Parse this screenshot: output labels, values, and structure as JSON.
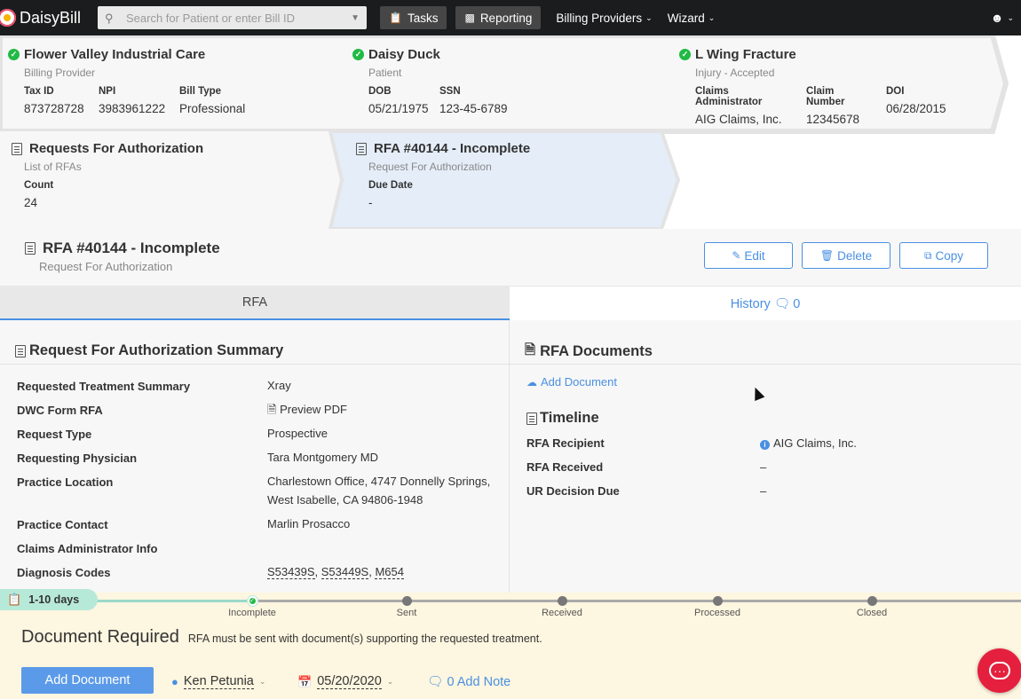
{
  "app": {
    "name": "DaisyBill"
  },
  "nav": {
    "search_placeholder": "Search for Patient or enter Bill ID",
    "tasks_label": "Tasks",
    "reporting_label": "Reporting",
    "billing_providers_label": "Billing Providers",
    "wizard_label": "Wizard"
  },
  "breadcrumbs": {
    "provider": {
      "title": "Flower Valley Industrial Care",
      "subtitle": "Billing Provider",
      "fields": [
        {
          "label": "Tax ID",
          "value": "873728728"
        },
        {
          "label": "NPI",
          "value": "3983961222"
        },
        {
          "label": "Bill Type",
          "value": "Professional"
        }
      ]
    },
    "patient": {
      "title": "Daisy Duck",
      "subtitle": "Patient",
      "fields": [
        {
          "label": "DOB",
          "value": "05/21/1975"
        },
        {
          "label": "SSN",
          "value": "123-45-6789"
        }
      ]
    },
    "injury": {
      "title": "L Wing Fracture",
      "subtitle": "Injury - Accepted",
      "fields": [
        {
          "label": "Claims Administrator",
          "value": "AIG Claims, Inc."
        },
        {
          "label": "Claim Number",
          "value": "12345678"
        },
        {
          "label": "DOI",
          "value": "06/28/2015"
        }
      ]
    },
    "rfas": {
      "title": "Requests For Authorization",
      "subtitle": "List of RFAs",
      "fields": [
        {
          "label": "Count",
          "value": "24"
        }
      ]
    },
    "current": {
      "title": "RFA #40144 - Incomplete",
      "subtitle": "Request For Authorization",
      "fields": [
        {
          "label": "Due Date",
          "value": "-"
        }
      ]
    }
  },
  "page": {
    "title": "RFA #40144 - Incomplete",
    "subtitle": "Request For Authorization",
    "edit_label": "Edit",
    "delete_label": "Delete",
    "copy_label": "Copy"
  },
  "tabs": {
    "rfa": "RFA",
    "history": "History",
    "history_count": "0"
  },
  "summary": {
    "heading": "Request For Authorization Summary",
    "rows": [
      {
        "label": "Requested Treatment Summary",
        "value": "Xray"
      },
      {
        "label": "DWC Form RFA",
        "value": "Preview PDF"
      },
      {
        "label": "Request Type",
        "value": "Prospective"
      },
      {
        "label": "Requesting Physician",
        "value": "Tara Montgomery MD"
      },
      {
        "label": "Practice Location",
        "value": "Charlestown Office, 4747 Donnelly Springs,",
        "value2": "West Isabelle, CA 94806-1948"
      },
      {
        "label": "Practice Contact",
        "value": "Marlin Prosacco"
      },
      {
        "label": "Claims Administrator Info",
        "value": ""
      },
      {
        "label": "Diagnosis Codes",
        "codes": [
          "S53439S",
          "S53449S",
          "M654"
        ]
      }
    ]
  },
  "documents": {
    "heading": "RFA Documents",
    "add_label": "Add Document"
  },
  "timeline": {
    "heading": "Timeline",
    "rows": [
      {
        "label": "RFA Recipient",
        "value": "AIG Claims, Inc."
      },
      {
        "label": "RFA Received",
        "value": "–"
      },
      {
        "label": "UR Decision Due",
        "value": "–"
      }
    ]
  },
  "progress": {
    "badge": "1-10 days",
    "steps": [
      "Incomplete",
      "Sent",
      "Received",
      "Processed",
      "Closed"
    ],
    "completed": 1
  },
  "footer": {
    "heading": "Document Required",
    "message": "RFA must be sent with document(s) supporting the requested treatment.",
    "add_doc_label": "Add Document",
    "assignee": "Ken Petunia",
    "date": "05/20/2020",
    "note_count": "0",
    "note_label": "Add Note"
  },
  "colors": {
    "accent": "#4a90e2",
    "success": "#21ba45",
    "nav_bg": "#1b1c1d",
    "footer_bg": "#fdf6e0",
    "chat": "#e4203e"
  },
  "icons": [
    "search-icon",
    "clipboard-icon",
    "bar-chart-icon",
    "user-circle-icon",
    "check-circle-icon",
    "document-icon",
    "pencil-icon",
    "trash-icon",
    "copy-icon",
    "comment-icon",
    "pdf-icon",
    "cloud-upload-icon",
    "info-icon",
    "user-icon",
    "calendar-icon",
    "chat-icon"
  ]
}
